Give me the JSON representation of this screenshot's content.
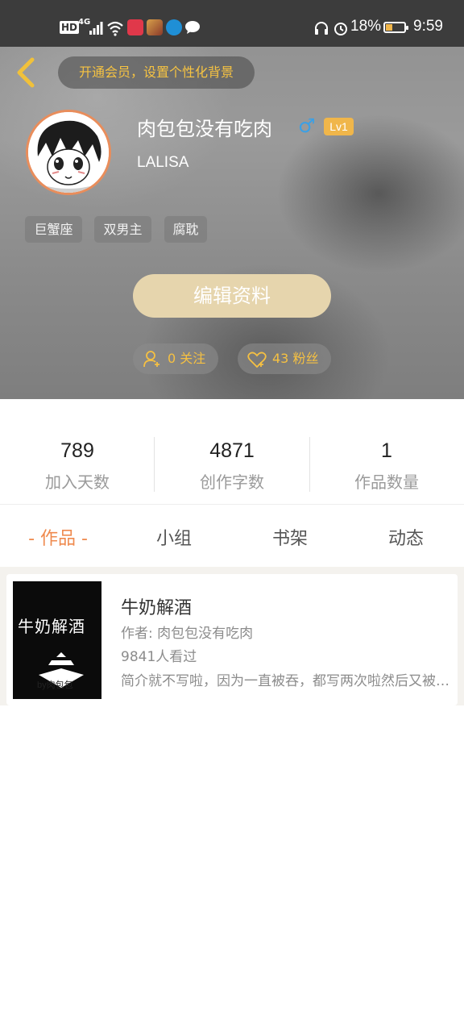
{
  "status_bar": {
    "hd": "HD",
    "network": "4G",
    "battery_percent": "18%",
    "time": "9:59"
  },
  "header": {
    "vip_prompt": "开通会员，设置个性化背景",
    "username": "肉包包没有吃肉",
    "gender_symbol": "♂",
    "level": "Lv1",
    "subname": "LALISA",
    "tags": [
      "巨蟹座",
      "双男主",
      "腐耽"
    ],
    "edit_button": "编辑资料",
    "following_label": "0 关注",
    "followers_label": "43 粉丝"
  },
  "stats": [
    {
      "value": "789",
      "label": "加入天数"
    },
    {
      "value": "4871",
      "label": "创作字数"
    },
    {
      "value": "1",
      "label": "作品数量"
    }
  ],
  "tabs": {
    "active": "- 作品 -",
    "items": [
      "小组",
      "书架",
      "动态"
    ]
  },
  "works": [
    {
      "cover_text": "牛奶解酒",
      "cover_signature": "by肉包包",
      "title": "牛奶解酒",
      "author": "作者: 肉包包没有吃肉",
      "views": "9841人看过",
      "description": "简介就不写啦，因为一直被吞，都写两次啦然后又被吞了"
    }
  ],
  "colors": {
    "accent": "#ef8a4e",
    "gold": "#f5c042",
    "level_badge": "#f0b64a",
    "gender_blue": "#3aa0e6"
  }
}
